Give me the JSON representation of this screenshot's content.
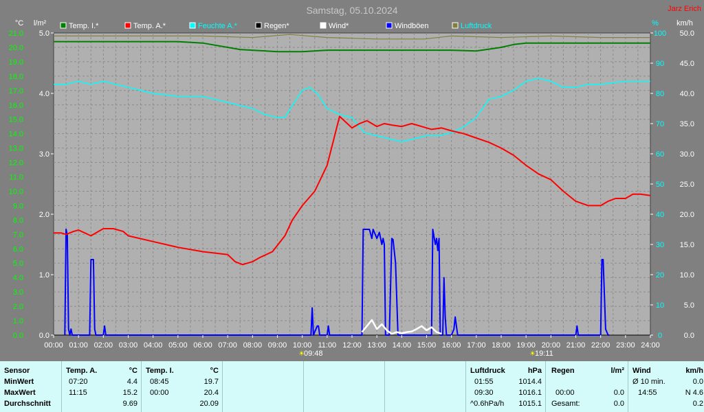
{
  "title": "Samstag, 05.10.2024",
  "author": "Jarz Erich",
  "legend": [
    {
      "name": "Temp. I.*",
      "color": "#008000"
    },
    {
      "name": "Temp. A.*",
      "color": "#ff0000"
    },
    {
      "name": "Feuchte A.*",
      "color": "#00ffff"
    },
    {
      "name": "Regen*",
      "color": "#000000"
    },
    {
      "name": "Wind*",
      "color": "#ffffff"
    },
    {
      "name": "Windböen",
      "color": "#0000ff"
    },
    {
      "name": "Luftdruck",
      "color": "#808040"
    }
  ],
  "axis_units": {
    "temp": "°C",
    "rain": "l/m²",
    "humidity": "%",
    "wind": "km/h"
  },
  "markers": {
    "sunrise": "09:48",
    "sunset": "19:11"
  },
  "chart_data": {
    "type": "line",
    "x_ticks": [
      "00:00",
      "01:00",
      "02:00",
      "03:00",
      "04:00",
      "05:00",
      "06:00",
      "07:00",
      "08:00",
      "09:00",
      "10:00",
      "11:00",
      "12:00",
      "13:00",
      "14:00",
      "15:00",
      "16:00",
      "17:00",
      "18:00",
      "19:00",
      "20:00",
      "21:00",
      "22:00",
      "23:00",
      "24:00"
    ],
    "temp_ticks": [
      "0.0",
      "1.0",
      "2.0",
      "3.0",
      "4.0",
      "5.0",
      "6.0",
      "7.0",
      "8.0",
      "9.0",
      "10.0",
      "11.0",
      "12.0",
      "13.0",
      "14.0",
      "15.0",
      "16.0",
      "17.0",
      "18.0",
      "19.0",
      "20.0",
      "21.0"
    ],
    "rain_ticks": [
      "0.0",
      "1.0",
      "2.0",
      "3.0",
      "4.0",
      "5.0"
    ],
    "humidity_ticks": [
      "0",
      "10",
      "20",
      "30",
      "40",
      "50",
      "60",
      "70",
      "80",
      "90",
      "100"
    ],
    "wind_ticks": [
      "0.0",
      "5.0",
      "10.0",
      "15.0",
      "20.0",
      "25.0",
      "30.0",
      "35.0",
      "40.0",
      "45.0",
      "50.0"
    ],
    "ylim_temp": [
      0,
      21
    ],
    "ylim_rain": [
      0,
      5
    ],
    "ylim_humidity": [
      0,
      100
    ],
    "ylim_wind": [
      0,
      50
    ],
    "xlim_hours": [
      0,
      24
    ],
    "series": [
      {
        "name": "Temp. I.*",
        "color": "#008000",
        "axis": "temp",
        "x": [
          0,
          5,
          6,
          7,
          7.5,
          9,
          10,
          11,
          14,
          16,
          17,
          18,
          18.5,
          19,
          24
        ],
        "y": [
          20.4,
          20.4,
          20.3,
          20.0,
          19.85,
          19.7,
          19.7,
          19.8,
          19.8,
          19.8,
          19.75,
          20.0,
          20.2,
          20.3,
          20.3
        ]
      },
      {
        "name": "Temp. A.*",
        "color": "#ff0000",
        "axis": "temp",
        "x": [
          0,
          0.3,
          0.5,
          0.8,
          1.0,
          1.5,
          1.8,
          2.0,
          2.4,
          2.8,
          3.0,
          4.0,
          5.0,
          6.0,
          7.0,
          7.3,
          7.6,
          8.0,
          8.3,
          8.8,
          9.3,
          9.6,
          10.0,
          10.5,
          11.0,
          11.25,
          11.5,
          12.0,
          12.3,
          12.6,
          13.0,
          13.3,
          13.6,
          14.0,
          14.4,
          14.8,
          15.2,
          15.6,
          16.0,
          16.5,
          17.0,
          17.5,
          18.0,
          18.5,
          19.0,
          19.5,
          20.0,
          20.5,
          21.0,
          21.5,
          22.0,
          22.3,
          22.6,
          23.0,
          23.3,
          23.6,
          24.0
        ],
        "y": [
          7.1,
          7.1,
          7.0,
          7.2,
          7.3,
          6.9,
          7.2,
          7.4,
          7.4,
          7.2,
          6.9,
          6.5,
          6.1,
          5.8,
          5.6,
          5.1,
          4.9,
          5.1,
          5.4,
          5.8,
          6.9,
          8.0,
          9.0,
          10.0,
          11.8,
          13.5,
          15.2,
          14.4,
          14.7,
          14.9,
          14.5,
          14.7,
          14.6,
          14.5,
          14.7,
          14.5,
          14.3,
          14.4,
          14.2,
          14.0,
          13.7,
          13.4,
          13.0,
          12.5,
          11.8,
          11.2,
          10.8,
          10.0,
          9.3,
          9.0,
          9.0,
          9.3,
          9.5,
          9.5,
          9.8,
          9.8,
          9.7
        ]
      },
      {
        "name": "Feuchte A.*",
        "color": "#00ffff",
        "axis": "humidity",
        "x": [
          0,
          0.5,
          1.0,
          1.5,
          2.0,
          2.5,
          3.0,
          3.5,
          4.0,
          5.0,
          6.0,
          7.0,
          7.5,
          8.0,
          8.5,
          9.0,
          9.3,
          9.6,
          10.0,
          10.3,
          10.6,
          11.0,
          11.5,
          12.0,
          12.5,
          13.0,
          13.5,
          14.0,
          14.5,
          15.0,
          15.5,
          16.0,
          16.5,
          17.0,
          17.5,
          18.0,
          18.5,
          19.0,
          19.5,
          20.0,
          20.5,
          21.0,
          21.5,
          22.0,
          23.0,
          24.0
        ],
        "y": [
          83,
          83,
          84,
          83,
          84,
          83,
          82,
          81,
          80,
          79,
          79,
          77,
          76,
          75,
          73,
          72,
          72,
          76,
          81,
          82,
          80,
          75,
          73,
          72,
          67,
          66,
          65,
          64,
          65,
          66,
          66,
          67,
          69,
          72,
          78,
          79,
          81,
          84,
          85,
          84,
          82,
          82,
          83,
          83,
          84,
          84
        ]
      },
      {
        "name": "Regen*",
        "color": "#000000",
        "axis": "rain",
        "x": [
          0,
          24
        ],
        "y": [
          0,
          0
        ]
      },
      {
        "name": "Wind*",
        "color": "#ffffff",
        "axis": "wind",
        "x": [
          12.4,
          12.6,
          12.8,
          13.0,
          13.2,
          13.4,
          13.6,
          13.8,
          14.0,
          14.2,
          14.4,
          14.6,
          14.8,
          15.0,
          15.2,
          15.4,
          15.6
        ],
        "y": [
          0.5,
          1.5,
          2.5,
          1.0,
          1.8,
          0.8,
          0.2,
          0.5,
          0.3,
          0.5,
          0.6,
          1.0,
          1.5,
          0.8,
          1.3,
          0.5,
          0.2
        ]
      },
      {
        "name": "Windböen",
        "color": "#0000ff",
        "axis": "wind",
        "x": [
          0.45,
          0.5,
          0.55,
          0.6,
          0.65,
          0.7,
          0.75,
          0.8,
          1.45,
          1.5,
          1.55,
          1.6,
          1.65,
          1.7,
          2.0,
          2.05,
          2.1,
          10.35,
          10.4,
          10.45,
          10.6,
          10.65,
          10.7,
          11.0,
          11.05,
          11.1,
          11.3,
          12.4,
          12.45,
          12.7,
          12.8,
          12.85,
          13.0,
          13.1,
          13.2,
          13.25,
          13.3,
          13.35,
          13.5,
          13.6,
          13.65,
          13.75,
          13.85,
          13.95,
          15.2,
          15.25,
          15.35,
          15.4,
          15.45,
          15.5,
          15.55,
          15.65,
          15.7,
          15.75,
          15.8,
          15.85,
          15.9,
          16.0,
          16.1,
          16.15,
          16.25,
          21.0,
          21.05,
          21.1,
          22.0,
          22.05,
          22.1,
          22.2,
          22.3,
          22.35
        ],
        "y": [
          0,
          17.5,
          16.5,
          1,
          0,
          1,
          0,
          0,
          0,
          12.5,
          12.5,
          12.5,
          1,
          0,
          0,
          1.5,
          0,
          0,
          4.5,
          0,
          1.5,
          1.5,
          0,
          0,
          1.5,
          0,
          0,
          0,
          17.5,
          17.5,
          16,
          17.5,
          16,
          17,
          15,
          16,
          15,
          0,
          0,
          16,
          15.8,
          12,
          0,
          0,
          0,
          17.5,
          15,
          16,
          14,
          16,
          0,
          0,
          9.5,
          3,
          0,
          0,
          0,
          0,
          1,
          3,
          0,
          0,
          1.5,
          0,
          0,
          12.5,
          12.5,
          1,
          0,
          0
        ]
      },
      {
        "name": "Luftdruck",
        "color": "#808040",
        "axis": "humidity",
        "x": [
          0,
          2,
          4,
          6,
          8,
          9.5,
          11,
          13,
          14.9,
          16,
          18,
          20,
          22,
          24
        ],
        "y": [
          99,
          99,
          99,
          99,
          98.5,
          99.5,
          98.5,
          98,
          98,
          99,
          98.5,
          99,
          98.5,
          98.5
        ]
      }
    ]
  },
  "stats": {
    "sensor_header": "Sensor",
    "row_labels": [
      "MinWert",
      "MaxWert",
      "Durchschnitt"
    ],
    "temp_a": {
      "header": "Temp. A.",
      "unit": "°C",
      "min_time": "07:20",
      "min": "4.4",
      "max_time": "11:15",
      "max": "15.2",
      "avg": "9.69"
    },
    "temp_i": {
      "header": "Temp. I.",
      "unit": "°C",
      "min_time": "08:45",
      "min": "19.7",
      "max_time": "00:00",
      "max": "20.4",
      "avg": "20.09"
    },
    "pressure": {
      "header": "Luftdruck",
      "unit": "hPa",
      "min_time": "01:55",
      "min": "1014.4",
      "max_time": "09:30",
      "max": "1016.1",
      "trend": "^0.6hPa/h",
      "avg": "1015.1"
    },
    "rain": {
      "header": "Regen",
      "unit": "l/m²",
      "max_time": "00:00",
      "max": "0.0",
      "total_label": "Gesamt:",
      "total": "0.0"
    },
    "wind": {
      "header": "Wind",
      "unit": "km/h",
      "avg_label": "Ø 10 min.",
      "avg": "0.0",
      "max_time": "14:55",
      "max": "N 4.6",
      "gust_avg": "0.2"
    }
  }
}
